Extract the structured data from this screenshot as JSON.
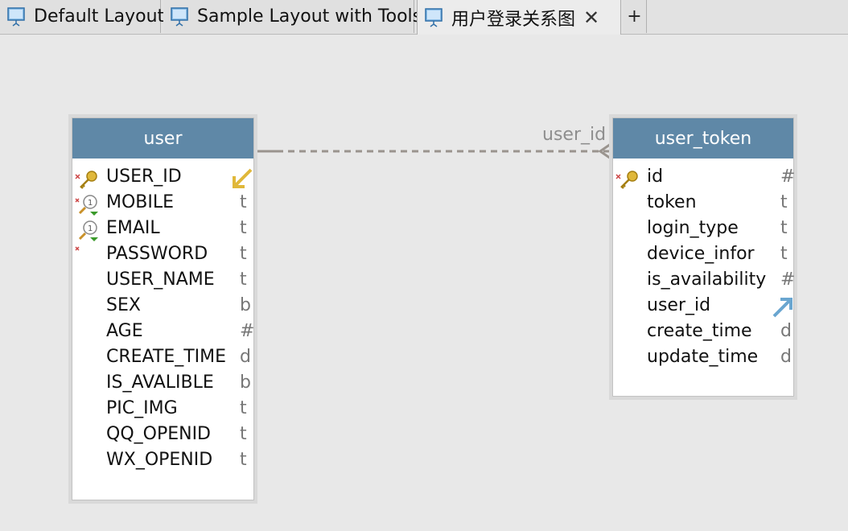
{
  "tabs": [
    {
      "label": "Default Layout"
    },
    {
      "label": "Sample Layout with Tools"
    },
    {
      "label": "用户登录关系图"
    }
  ],
  "tab_add_label": "+",
  "tab_close_label": "✕",
  "relationship": {
    "label": "user_id"
  },
  "tables": {
    "user": {
      "name": "user",
      "columns": [
        {
          "name": "USER_ID",
          "type": ""
        },
        {
          "name": "MOBILE",
          "type": "t"
        },
        {
          "name": "EMAIL",
          "type": "t"
        },
        {
          "name": "PASSWORD",
          "type": "t"
        },
        {
          "name": "USER_NAME",
          "type": "t"
        },
        {
          "name": "SEX",
          "type": "b"
        },
        {
          "name": "AGE",
          "type": "#"
        },
        {
          "name": "CREATE_TIME",
          "type": "d"
        },
        {
          "name": "IS_AVALIBLE",
          "type": "b"
        },
        {
          "name": "PIC_IMG",
          "type": "t"
        },
        {
          "name": "QQ_OPENID",
          "type": "t"
        },
        {
          "name": "WX_OPENID",
          "type": "t"
        }
      ]
    },
    "user_token": {
      "name": "user_token",
      "columns": [
        {
          "name": "id",
          "type": "#"
        },
        {
          "name": "token",
          "type": "t"
        },
        {
          "name": "login_type",
          "type": "t"
        },
        {
          "name": "device_infor",
          "type": "t"
        },
        {
          "name": "is_availability",
          "type": "#"
        },
        {
          "name": "user_id",
          "type": ""
        },
        {
          "name": "create_time",
          "type": "d"
        },
        {
          "name": "update_time",
          "type": "d"
        }
      ]
    }
  },
  "colors": {
    "header": "#5f88a7",
    "canvas": "#e8e8e8",
    "key_icon": "#e0b83a",
    "fk_arrow": "#6aa6d0"
  }
}
